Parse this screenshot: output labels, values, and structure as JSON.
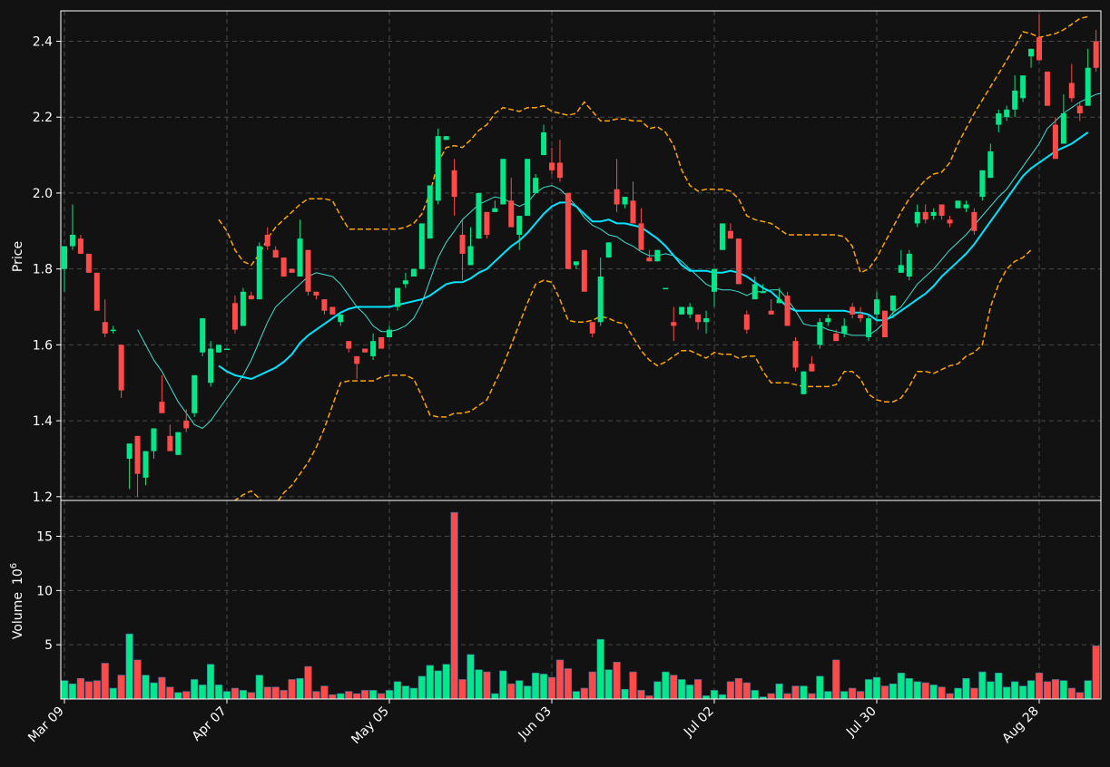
{
  "chart_data": {
    "type": "candlestick",
    "colors": {
      "background": "#121212",
      "up": "#00e88a",
      "down": "#ff4a4a",
      "sma_slow": "#00e5ff",
      "sma_fast": "#40e0d0",
      "bollinger": "#ffa500",
      "grid": "#4a4a4a",
      "axis": "#ffffff"
    },
    "price_axis": {
      "label": "Price",
      "ylim": [
        1.19,
        2.48
      ],
      "ticks": [
        "1.2",
        "1.4",
        "1.6",
        "1.8",
        "2.0",
        "2.2",
        "2.4"
      ]
    },
    "volume_axis": {
      "label": "Volume",
      "exponent": "10",
      "exponent_power": "6",
      "ylim": [
        0,
        18.3
      ],
      "ticks": [
        "5",
        "10",
        "15"
      ]
    },
    "x_ticks": [
      {
        "index": 0,
        "label": "Mar 09"
      },
      {
        "index": 20,
        "label": "Apr 07"
      },
      {
        "index": 40,
        "label": "May 05"
      },
      {
        "index": 60,
        "label": "Jun 03"
      },
      {
        "index": 80,
        "label": "Jul 02"
      },
      {
        "index": 100,
        "label": "Jul 30"
      },
      {
        "index": 120,
        "label": "Aug 28"
      }
    ],
    "candles": [
      [
        1.8,
        1.86,
        1.74,
        1.86,
        1.7
      ],
      [
        1.86,
        1.97,
        1.85,
        1.89,
        1.4
      ],
      [
        1.88,
        1.89,
        1.84,
        1.84,
        1.9
      ],
      [
        1.84,
        1.84,
        1.79,
        1.79,
        1.6
      ],
      [
        1.79,
        1.79,
        1.69,
        1.69,
        1.7
      ],
      [
        1.66,
        1.72,
        1.62,
        1.63,
        3.3
      ],
      [
        1.64,
        1.65,
        1.63,
        1.64,
        1.0
      ],
      [
        1.6,
        1.6,
        1.46,
        1.48,
        2.2
      ],
      [
        1.3,
        1.34,
        1.22,
        1.34,
        6.0
      ],
      [
        1.36,
        1.36,
        1.2,
        1.26,
        3.6
      ],
      [
        1.25,
        1.32,
        1.23,
        1.32,
        2.2
      ],
      [
        1.32,
        1.38,
        1.3,
        1.38,
        1.5
      ],
      [
        1.45,
        1.52,
        1.43,
        1.42,
        2.0
      ],
      [
        1.36,
        1.39,
        1.32,
        1.32,
        1.1
      ],
      [
        1.31,
        1.37,
        1.31,
        1.37,
        0.6
      ],
      [
        1.4,
        1.43,
        1.37,
        1.38,
        0.7
      ],
      [
        1.42,
        1.52,
        1.41,
        1.52,
        1.8
      ],
      [
        1.58,
        1.67,
        1.57,
        1.67,
        1.3
      ],
      [
        1.5,
        1.61,
        1.49,
        1.59,
        3.2
      ],
      [
        1.58,
        1.6,
        1.58,
        1.6,
        1.3
      ],
      [
        1.59,
        1.59,
        1.59,
        1.59,
        0.7
      ],
      [
        1.71,
        1.73,
        1.63,
        1.64,
        1.0
      ],
      [
        1.65,
        1.75,
        1.65,
        1.74,
        0.8
      ],
      [
        1.73,
        1.74,
        1.72,
        1.72,
        0.6
      ],
      [
        1.72,
        1.87,
        1.72,
        1.86,
        2.2
      ],
      [
        1.89,
        1.91,
        1.85,
        1.86,
        1.1
      ],
      [
        1.85,
        1.86,
        1.83,
        1.83,
        1.1
      ],
      [
        1.83,
        1.83,
        1.78,
        1.78,
        0.8
      ],
      [
        1.8,
        1.8,
        1.79,
        1.79,
        1.8
      ],
      [
        1.78,
        1.93,
        1.78,
        1.88,
        1.9
      ],
      [
        1.85,
        1.85,
        1.73,
        1.74,
        3.0
      ],
      [
        1.74,
        1.74,
        1.72,
        1.73,
        0.7
      ],
      [
        1.72,
        1.72,
        1.68,
        1.69,
        1.2
      ],
      [
        1.7,
        1.7,
        1.68,
        1.68,
        0.4
      ],
      [
        1.66,
        1.68,
        1.65,
        1.68,
        0.5
      ],
      [
        1.61,
        1.61,
        1.58,
        1.59,
        0.7
      ],
      [
        1.57,
        1.57,
        1.51,
        1.55,
        0.5
      ],
      [
        1.59,
        1.59,
        1.58,
        1.58,
        0.8
      ],
      [
        1.57,
        1.63,
        1.56,
        1.61,
        0.8
      ],
      [
        1.62,
        1.62,
        1.59,
        1.59,
        0.5
      ],
      [
        1.62,
        1.65,
        1.62,
        1.64,
        0.8
      ],
      [
        1.7,
        1.75,
        1.69,
        1.75,
        1.6
      ],
      [
        1.76,
        1.79,
        1.75,
        1.77,
        1.2
      ],
      [
        1.78,
        1.8,
        1.78,
        1.8,
        1.0
      ],
      [
        1.8,
        1.92,
        1.8,
        1.92,
        2.1
      ],
      [
        1.88,
        2.02,
        1.88,
        2.02,
        3.1
      ],
      [
        1.98,
        2.17,
        1.97,
        2.15,
        2.6
      ],
      [
        2.14,
        2.15,
        2.14,
        2.15,
        3.2
      ],
      [
        2.06,
        2.09,
        1.94,
        1.99,
        17.2
      ],
      [
        1.89,
        1.93,
        1.77,
        1.84,
        1.8
      ],
      [
        1.81,
        1.91,
        1.81,
        1.86,
        4.1
      ],
      [
        1.88,
        2.0,
        1.88,
        2.0,
        2.7
      ],
      [
        1.95,
        1.95,
        1.88,
        1.89,
        2.5
      ],
      [
        1.95,
        1.98,
        1.95,
        1.96,
        0.5
      ],
      [
        1.97,
        2.09,
        1.97,
        2.09,
        2.6
      ],
      [
        1.98,
        2.04,
        1.91,
        1.91,
        1.4
      ],
      [
        1.89,
        1.92,
        1.85,
        1.94,
        1.7
      ],
      [
        1.94,
        2.09,
        1.94,
        2.09,
        1.2
      ],
      [
        2.0,
        2.05,
        2.0,
        2.04,
        2.4
      ],
      [
        2.1,
        2.18,
        2.1,
        2.16,
        2.3
      ],
      [
        2.08,
        2.12,
        2.05,
        2.06,
        2.0
      ],
      [
        2.08,
        2.14,
        2.03,
        2.04,
        3.6
      ],
      [
        2.0,
        2.0,
        1.8,
        1.8,
        2.8
      ],
      [
        1.81,
        1.81,
        1.8,
        1.82,
        0.7
      ],
      [
        1.85,
        1.85,
        1.74,
        1.74,
        1.0
      ],
      [
        1.66,
        1.66,
        1.62,
        1.63,
        2.5
      ],
      [
        1.66,
        1.83,
        1.65,
        1.78,
        5.5
      ],
      [
        1.83,
        1.87,
        1.83,
        1.87,
        2.7
      ],
      [
        2.01,
        2.09,
        1.95,
        1.97,
        3.4
      ],
      [
        1.97,
        1.99,
        1.96,
        1.99,
        0.9
      ],
      [
        1.98,
        2.03,
        1.92,
        1.92,
        2.5
      ],
      [
        1.92,
        1.96,
        1.85,
        1.85,
        0.8
      ],
      [
        1.83,
        1.85,
        1.82,
        1.82,
        0.3
      ],
      [
        1.82,
        1.85,
        1.82,
        1.85,
        1.6
      ],
      [
        1.75,
        1.75,
        1.75,
        1.75,
        2.5
      ],
      [
        1.66,
        1.7,
        1.61,
        1.65,
        2.2
      ],
      [
        1.68,
        1.7,
        1.68,
        1.7,
        1.8
      ],
      [
        1.68,
        1.71,
        1.67,
        1.7,
        1.3
      ],
      [
        1.68,
        1.68,
        1.64,
        1.66,
        1.8
      ],
      [
        1.66,
        1.69,
        1.63,
        1.67,
        0.3
      ],
      [
        1.74,
        1.78,
        1.7,
        1.8,
        0.8
      ],
      [
        1.85,
        1.92,
        1.85,
        1.92,
        0.4
      ],
      [
        1.9,
        1.92,
        1.88,
        1.88,
        1.6
      ],
      [
        1.88,
        1.88,
        1.76,
        1.76,
        1.9
      ],
      [
        1.68,
        1.69,
        1.63,
        1.64,
        1.5
      ],
      [
        1.72,
        1.78,
        1.72,
        1.76,
        0.8
      ],
      [
        1.74,
        1.76,
        1.74,
        1.74,
        0.2
      ],
      [
        1.69,
        1.72,
        1.68,
        1.68,
        0.5
      ],
      [
        1.71,
        1.75,
        1.71,
        1.72,
        1.4
      ],
      [
        1.73,
        1.74,
        1.65,
        1.65,
        0.5
      ],
      [
        1.61,
        1.62,
        1.53,
        1.54,
        1.2
      ],
      [
        1.47,
        1.53,
        1.47,
        1.53,
        1.2
      ],
      [
        1.55,
        1.57,
        1.53,
        1.53,
        0.5
      ],
      [
        1.6,
        1.67,
        1.59,
        1.66,
        2.1
      ],
      [
        1.66,
        1.68,
        1.65,
        1.67,
        0.7
      ],
      [
        1.63,
        1.64,
        1.61,
        1.61,
        3.6
      ],
      [
        1.63,
        1.67,
        1.62,
        1.65,
        0.7
      ],
      [
        1.7,
        1.71,
        1.67,
        1.68,
        1.0
      ],
      [
        1.68,
        1.7,
        1.66,
        1.67,
        0.7
      ],
      [
        1.62,
        1.68,
        1.61,
        1.67,
        1.8
      ],
      [
        1.68,
        1.74,
        1.66,
        1.72,
        2.0
      ],
      [
        1.69,
        1.69,
        1.62,
        1.62,
        1.2
      ],
      [
        1.69,
        1.73,
        1.67,
        1.73,
        1.4
      ],
      [
        1.79,
        1.85,
        1.79,
        1.81,
        2.4
      ],
      [
        1.78,
        1.85,
        1.77,
        1.84,
        1.9
      ],
      [
        1.92,
        1.97,
        1.91,
        1.95,
        1.6
      ],
      [
        1.95,
        1.97,
        1.92,
        1.93,
        1.5
      ],
      [
        1.94,
        1.96,
        1.93,
        1.95,
        1.3
      ],
      [
        1.97,
        1.97,
        1.93,
        1.94,
        1.1
      ],
      [
        1.93,
        1.94,
        1.91,
        1.92,
        0.5
      ],
      [
        1.96,
        1.98,
        1.96,
        1.98,
        1.0
      ],
      [
        1.96,
        1.98,
        1.95,
        1.97,
        1.9
      ],
      [
        1.95,
        1.96,
        1.89,
        1.9,
        1.0
      ],
      [
        1.99,
        2.06,
        1.98,
        2.06,
        2.5
      ],
      [
        2.04,
        2.13,
        2.04,
        2.11,
        1.6
      ],
      [
        2.18,
        2.22,
        2.16,
        2.21,
        2.4
      ],
      [
        2.2,
        2.23,
        2.19,
        2.22,
        1.1
      ],
      [
        2.22,
        2.31,
        2.2,
        2.27,
        1.6
      ],
      [
        2.25,
        2.29,
        2.24,
        2.31,
        1.2
      ],
      [
        2.36,
        2.38,
        2.33,
        2.38,
        1.7
      ],
      [
        2.41,
        2.47,
        2.36,
        2.35,
        2.4
      ],
      [
        2.32,
        2.32,
        2.23,
        2.23,
        1.6
      ],
      [
        2.18,
        2.2,
        2.1,
        2.09,
        1.8
      ],
      [
        2.13,
        2.26,
        2.13,
        2.21,
        1.7
      ],
      [
        2.29,
        2.34,
        2.24,
        2.25,
        1.0
      ],
      [
        2.23,
        2.24,
        2.19,
        2.21,
        0.6
      ],
      [
        2.23,
        2.38,
        2.23,
        2.33,
        1.7
      ],
      [
        2.4,
        2.43,
        2.32,
        2.33,
        4.9
      ]
    ],
    "sma_fast": [
      null,
      null,
      null,
      null,
      null,
      null,
      null,
      null,
      null,
      1.64,
      1.6,
      1.56,
      1.53,
      1.49,
      1.45,
      1.42,
      1.39,
      1.38,
      1.4,
      1.43,
      1.46,
      1.49,
      1.52,
      1.56,
      1.61,
      1.66,
      1.7,
      1.72,
      1.74,
      1.76,
      1.78,
      1.79,
      1.785,
      1.78,
      1.76,
      1.73,
      1.7,
      1.68,
      1.65,
      1.635,
      1.635,
      1.64,
      1.65,
      1.67,
      1.71,
      1.77,
      1.83,
      1.87,
      1.9,
      1.93,
      1.95,
      1.97,
      1.98,
      1.99,
      1.985,
      1.975,
      1.965,
      1.975,
      2.0,
      2.015,
      2.02,
      2.01,
      1.99,
      1.965,
      1.935,
      1.915,
      1.905,
      1.89,
      1.885,
      1.87,
      1.86,
      1.845,
      1.835,
      1.835,
      1.84,
      1.835,
      1.82,
      1.8,
      1.78,
      1.76,
      1.75,
      1.745,
      1.745,
      1.74,
      1.73,
      1.74,
      1.74,
      1.745,
      1.745,
      1.72,
      1.69,
      1.655,
      1.65,
      1.65,
      1.64,
      1.635,
      1.63,
      1.625,
      1.625,
      1.625,
      1.64,
      1.66,
      1.685,
      1.7,
      1.73,
      1.76,
      1.78,
      1.8,
      1.825,
      1.85,
      1.87,
      1.89,
      1.915,
      1.94,
      1.965,
      1.99,
      2.01,
      2.04,
      2.07,
      2.1,
      2.13,
      2.17,
      2.19,
      2.21,
      2.225,
      2.24,
      2.25,
      2.26,
      2.265,
      2.27
    ],
    "sma_slow": [
      null,
      null,
      null,
      null,
      null,
      null,
      null,
      null,
      null,
      null,
      null,
      null,
      null,
      null,
      null,
      null,
      null,
      null,
      null,
      1.545,
      1.53,
      1.52,
      1.515,
      1.51,
      1.52,
      1.53,
      1.54,
      1.555,
      1.575,
      1.605,
      1.625,
      1.64,
      1.655,
      1.67,
      1.685,
      1.695,
      1.7,
      1.7,
      1.7,
      1.7,
      1.7,
      1.705,
      1.71,
      1.715,
      1.72,
      1.73,
      1.745,
      1.76,
      1.765,
      1.765,
      1.775,
      1.79,
      1.8,
      1.82,
      1.84,
      1.86,
      1.875,
      1.895,
      1.92,
      1.945,
      1.965,
      1.975,
      1.975,
      1.965,
      1.945,
      1.925,
      1.925,
      1.93,
      1.92,
      1.92,
      1.915,
      1.91,
      1.895,
      1.88,
      1.86,
      1.835,
      1.81,
      1.795,
      1.795,
      1.795,
      1.79,
      1.79,
      1.795,
      1.79,
      1.78,
      1.765,
      1.75,
      1.74,
      1.72,
      1.7,
      1.69,
      1.69,
      1.69,
      1.69,
      1.69,
      1.69,
      1.69,
      1.685,
      1.685,
      1.68,
      1.665,
      1.665,
      1.675,
      1.69,
      1.705,
      1.72,
      1.735,
      1.755,
      1.78,
      1.8,
      1.82,
      1.84,
      1.865,
      1.895,
      1.925,
      1.955,
      1.985,
      2.015,
      2.045,
      2.065,
      2.08,
      2.095,
      2.11,
      2.12,
      2.13,
      2.145,
      2.16
    ],
    "bb_upper": [
      null,
      null,
      null,
      null,
      null,
      null,
      null,
      null,
      null,
      null,
      null,
      null,
      null,
      null,
      null,
      null,
      null,
      null,
      null,
      1.93,
      1.9,
      1.85,
      1.82,
      1.81,
      1.84,
      1.88,
      1.91,
      1.93,
      1.95,
      1.97,
      1.985,
      1.985,
      1.985,
      1.98,
      1.94,
      1.905,
      1.905,
      1.905,
      1.905,
      1.905,
      1.905,
      1.905,
      1.91,
      1.92,
      1.945,
      2.0,
      2.08,
      2.12,
      2.125,
      2.12,
      2.14,
      2.165,
      2.18,
      2.21,
      2.225,
      2.22,
      2.215,
      2.225,
      2.225,
      2.23,
      2.215,
      2.21,
      2.205,
      2.21,
      2.24,
      2.215,
      2.19,
      2.19,
      2.195,
      2.195,
      2.19,
      2.19,
      2.17,
      2.175,
      2.16,
      2.125,
      2.06,
      2.02,
      2.005,
      2.01,
      2.01,
      2.01,
      2.005,
      1.985,
      1.94,
      1.93,
      1.925,
      1.92,
      1.905,
      1.89,
      1.89,
      1.89,
      1.89,
      1.89,
      1.89,
      1.89,
      1.885,
      1.86,
      1.79,
      1.8,
      1.83,
      1.87,
      1.91,
      1.95,
      1.985,
      2.01,
      2.035,
      2.05,
      2.055,
      2.08,
      2.13,
      2.17,
      2.21,
      2.245,
      2.28,
      2.315,
      2.35,
      2.385,
      2.425,
      2.42,
      2.41,
      2.415,
      2.42,
      2.43,
      2.445,
      2.46,
      2.465
    ],
    "bb_lower": [
      null,
      null,
      null,
      null,
      null,
      null,
      null,
      null,
      null,
      null,
      null,
      null,
      null,
      null,
      null,
      null,
      null,
      null,
      null,
      1.16,
      1.09,
      1.19,
      1.205,
      1.215,
      1.195,
      1.17,
      1.18,
      1.21,
      1.23,
      1.26,
      1.29,
      1.33,
      1.38,
      1.44,
      1.5,
      1.505,
      1.505,
      1.505,
      1.505,
      1.515,
      1.52,
      1.52,
      1.52,
      1.51,
      1.465,
      1.415,
      1.41,
      1.41,
      1.42,
      1.42,
      1.425,
      1.44,
      1.455,
      1.5,
      1.545,
      1.6,
      1.655,
      1.71,
      1.76,
      1.77,
      1.765,
      1.72,
      1.665,
      1.66,
      1.66,
      1.665,
      1.675,
      1.67,
      1.66,
      1.655,
      1.62,
      1.585,
      1.56,
      1.545,
      1.555,
      1.57,
      1.585,
      1.585,
      1.575,
      1.565,
      1.58,
      1.575,
      1.575,
      1.565,
      1.57,
      1.57,
      1.53,
      1.5,
      1.5,
      1.5,
      1.495,
      1.49,
      1.49,
      1.49,
      1.49,
      1.495,
      1.53,
      1.53,
      1.51,
      1.47,
      1.455,
      1.45,
      1.45,
      1.46,
      1.49,
      1.53,
      1.53,
      1.525,
      1.535,
      1.545,
      1.55,
      1.57,
      1.58,
      1.6,
      1.7,
      1.76,
      1.8,
      1.82,
      1.83,
      1.85
    ]
  }
}
